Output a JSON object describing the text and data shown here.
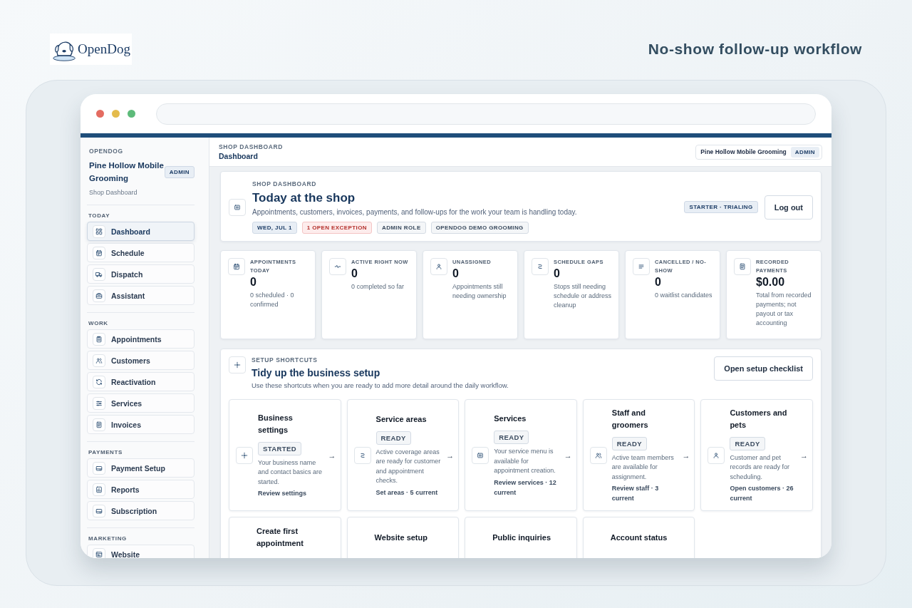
{
  "page": {
    "logo_text": "OpenDog",
    "title": "No-show follow-up workflow"
  },
  "sidebar": {
    "eyebrow": "OPENDOG",
    "business": "Pine Hollow Mobile Grooming",
    "role": "ADMIN",
    "subtitle": "Shop Dashboard",
    "sections": [
      {
        "label": "TODAY",
        "items": [
          {
            "label": "Dashboard",
            "kind": "grid",
            "selected": true
          },
          {
            "label": "Schedule",
            "kind": "calendar",
            "selected": false
          },
          {
            "label": "Dispatch",
            "kind": "truck",
            "selected": false
          },
          {
            "label": "Assistant",
            "kind": "bot",
            "selected": false
          }
        ]
      },
      {
        "label": "WORK",
        "items": [
          {
            "label": "Appointments",
            "kind": "clipboard",
            "selected": false
          },
          {
            "label": "Customers",
            "kind": "people",
            "selected": false
          },
          {
            "label": "Reactivation",
            "kind": "refresh",
            "selected": false
          },
          {
            "label": "Services",
            "kind": "sliders",
            "selected": false
          },
          {
            "label": "Invoices",
            "kind": "doc",
            "selected": false
          }
        ]
      },
      {
        "label": "PAYMENTS",
        "items": [
          {
            "label": "Payment Setup",
            "kind": "card",
            "selected": false
          },
          {
            "label": "Reports",
            "kind": "chart",
            "selected": false
          },
          {
            "label": "Subscription",
            "kind": "card",
            "selected": false
          }
        ]
      },
      {
        "label": "MARKETING",
        "items": [
          {
            "label": "Website",
            "kind": "browser",
            "selected": false
          }
        ]
      }
    ]
  },
  "topbar": {
    "eyebrow": "SHOP DASHBOARD",
    "title": "Dashboard",
    "account": "Pine Hollow Mobile Grooming",
    "account_role": "ADMIN"
  },
  "hero": {
    "eyebrow": "SHOP DASHBOARD",
    "title": "Today at the shop",
    "description": "Appointments, customers, invoices, payments, and follow-ups for the work your team is handling today.",
    "tags": [
      {
        "label": "WED, JUL 1",
        "kind": "info"
      },
      {
        "label": "1 OPEN EXCEPTION",
        "kind": "danger"
      },
      {
        "label": "ADMIN ROLE",
        "kind": "neutral"
      },
      {
        "label": "OPENDOG DEMO GROOMING",
        "kind": "neutral"
      }
    ],
    "plan": "STARTER · TRIALING",
    "logout": "Log out"
  },
  "stats": [
    {
      "label": "APPOINTMENTS TODAY",
      "value": "0",
      "note": "0 scheduled · 0 confirmed"
    },
    {
      "label": "ACTIVE RIGHT NOW",
      "value": "0",
      "note": "0 completed so far"
    },
    {
      "label": "UNASSIGNED",
      "value": "0",
      "note": "Appointments still needing ownership"
    },
    {
      "label": "SCHEDULE GAPS",
      "value": "0",
      "note": "Stops still needing schedule or address cleanup"
    },
    {
      "label": "CANCELLED / NO-SHOW",
      "value": "0",
      "note": "0 waitlist candidates"
    },
    {
      "label": "RECORDED PAYMENTS",
      "value": "$0.00",
      "note": "Total from recorded payments; not payout or tax accounting"
    }
  ],
  "setup": {
    "eyebrow": "SETUP SHORTCUTS",
    "title": "Tidy up the business setup",
    "description": "Use these shortcuts when you are ready to add more detail around the daily workflow.",
    "button": "Open setup checklist",
    "shortcuts": [
      {
        "title": "Business settings",
        "status": {
          "label": "STARTED",
          "kind": "neutral"
        },
        "description": "Your business name and contact basics are started.",
        "link": "Review settings",
        "arrow": "→"
      },
      {
        "title": "Service areas",
        "status": {
          "label": "READY",
          "kind": "neutral"
        },
        "description": "Active coverage areas are ready for customer and appointment checks.",
        "link": "Set areas · 5 current",
        "arrow": "→"
      },
      {
        "title": "Services",
        "status": {
          "label": "READY",
          "kind": "neutral"
        },
        "description": "Your service menu is available for appointment creation.",
        "link": "Review services · 12 current",
        "arrow": "→"
      },
      {
        "title": "Staff and groomers",
        "status": {
          "label": "READY",
          "kind": "neutral"
        },
        "description": "Active team members are available for assignment.",
        "link": "Review staff · 3 current",
        "arrow": "→"
      },
      {
        "title": "Customers and pets",
        "status": {
          "label": "READY",
          "kind": "neutral"
        },
        "description": "Customer and pet records are ready for scheduling.",
        "link": "Open customers · 26 current",
        "arrow": "→"
      },
      {
        "title": "Create first appointment"
      },
      {
        "title": "Website setup"
      },
      {
        "title": "Public inquiries"
      },
      {
        "title": "Account status"
      }
    ]
  }
}
